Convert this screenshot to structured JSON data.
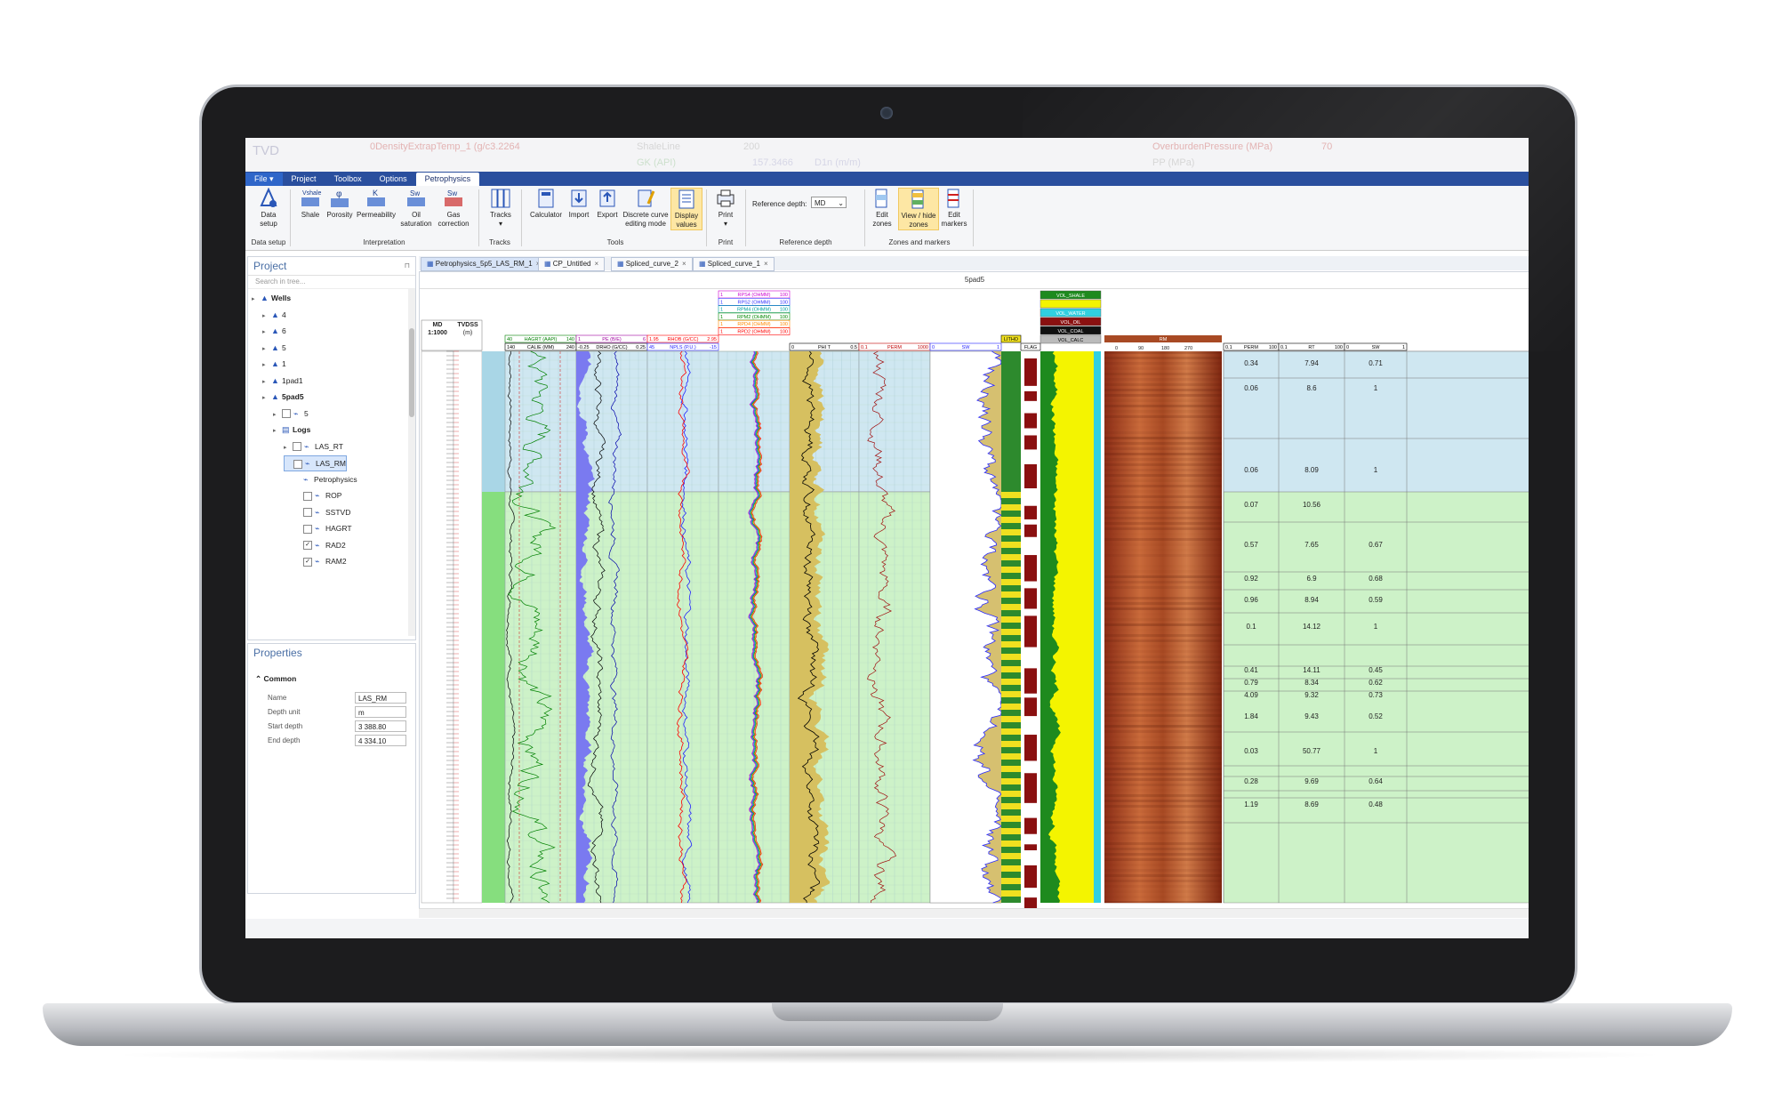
{
  "ribbon_tabs": [
    "File",
    "Project",
    "Toolbox",
    "Options",
    "Petrophysics"
  ],
  "ghost_header": {
    "tvd": "TVD",
    "left": "0DensityExtrapTemp_1 (g/c3.2264",
    "shaleline": "ShaleLine",
    "shaleline_max": "200",
    "overburden": "OverburdenPressure (MPa)",
    "overburden_max": "70",
    "row2_a": "GK (API)",
    "row2_b": "157.3466",
    "row2_c": "D1n (m/m)",
    "row2_d": "PP (MPa)"
  },
  "ribbon": {
    "data_setup": "Data setup",
    "shale": "Shale",
    "porosity": "Porosity",
    "permeability": "Permeability",
    "oil_saturation": "Oil saturation",
    "gas_correction": "Gas correction",
    "tracks": "Tracks",
    "calculator": "Calculator",
    "import": "Import",
    "export": "Export",
    "discrete": "Discrete curve editing mode",
    "display_values": "Display values",
    "print": "Print",
    "reference_depth_label": "Reference depth:",
    "reference_depth_value": "MD",
    "edit_zones": "Edit zones",
    "view_hide_zones": "View / hide zones",
    "edit_markers": "Edit markers",
    "groups": {
      "data_setup": "Data setup",
      "interpretation": "Interpretation",
      "tracks": "Tracks",
      "tools": "Tools",
      "print": "Print",
      "reference_depth": "Reference depth",
      "zones": "Zones and markers"
    }
  },
  "project": {
    "title": "Project",
    "search_placeholder": "Search in tree...",
    "tree": [
      {
        "label": "Wells",
        "level": 0
      },
      {
        "label": "4",
        "level": 1
      },
      {
        "label": "6",
        "level": 1
      },
      {
        "label": "5",
        "level": 1
      },
      {
        "label": "1",
        "level": 1
      },
      {
        "label": "1pad1",
        "level": 1
      },
      {
        "label": "5pad5",
        "level": 1
      },
      {
        "label": "5",
        "level": 2
      },
      {
        "label": "Logs",
        "level": 2
      },
      {
        "label": "LAS_RT",
        "level": 3
      },
      {
        "label": "LAS_RM",
        "level": 3
      },
      {
        "label": "Petrophysics",
        "level": 4
      },
      {
        "label": "ROP",
        "level": 4
      },
      {
        "label": "SSTVD",
        "level": 4
      },
      {
        "label": "HAGRT",
        "level": 4
      },
      {
        "label": "RAD2",
        "level": 4
      },
      {
        "label": "RAM2",
        "level": 4
      }
    ]
  },
  "properties": {
    "title": "Properties",
    "section": "Common",
    "rows": [
      {
        "label": "Name",
        "value": "LAS_RM"
      },
      {
        "label": "Depth unit",
        "value": "m"
      },
      {
        "label": "Start depth",
        "value": "3 388.80"
      },
      {
        "label": "End depth",
        "value": "4 334.10"
      }
    ]
  },
  "doc_tabs": [
    "Petrophysics_5p5_LAS_RM_1",
    "CP_Untitled",
    "Spliced_curve_2",
    "Spliced_curve_1"
  ],
  "log": {
    "well": "5pad5",
    "md_label": "MD",
    "md_scale": "1:1000",
    "tvdss_label": "TVDSS",
    "tvdss_unit": "(m)",
    "resistivity_curves": [
      {
        "name": "RPS4 (OHMM)",
        "min": "1",
        "max": "100",
        "color": "#d000d0"
      },
      {
        "name": "RPS2 (OHMM)",
        "min": "1",
        "max": "100",
        "color": "#3030ff"
      },
      {
        "name": "RPM4 (OHMM)",
        "min": "1",
        "max": "100",
        "color": "#00a0a0"
      },
      {
        "name": "RPM2 (OHMM)",
        "min": "1",
        "max": "100",
        "color": "#008800"
      },
      {
        "name": "RPD4 (OHMM)",
        "min": "1",
        "max": "100",
        "color": "#ff8800"
      },
      {
        "name": "RPD2 (OHMM)",
        "min": "1",
        "max": "100",
        "color": "#ff0000"
      }
    ],
    "track_headers": {
      "hagrt": "HAGRT (AAPI)",
      "hagrt_min": "40",
      "hagrt_max": "140",
      "calie": "CALIE (MM)",
      "calie_min": "140",
      "calie_max": "240",
      "pe": "PE (B/E)",
      "pe_min": "1",
      "pe_max": "6",
      "drho": "DRHO (G/CC)",
      "drho_min": "-0.25",
      "drho_max": "0.25",
      "rhob": "RHOB (G/CC)",
      "rhob_min": "1.95",
      "rhob_max": "2.95",
      "npls": "NPLS (P.U.)",
      "npls_min": "45",
      "npls_max": "-15",
      "phit": "PHI T",
      "phit_min": "0",
      "phit_max": "0.5",
      "perm": "PERM",
      "perm_min": "0.1",
      "perm_max": "1000",
      "sw": "SW",
      "sw_min": "0",
      "sw_max": "1",
      "lith_a": "LITHO",
      "lith_b": "FLAG",
      "vol_shale": "VOL_SHALE",
      "vol_water": "VOL_WATER",
      "vol_oil": "VOL_OIL",
      "vol_coal": "VOL_COAL",
      "vol_calc": "VOL_CALC",
      "rm": "RM",
      "img_ticks": [
        "0",
        "90",
        "180",
        "270"
      ],
      "tab_perm_min": "0.1",
      "tab_perm": "PERM",
      "tab_perm_max": "100",
      "tab_rt_min": "0.1",
      "tab_rt": "RT",
      "tab_rt_max": "100",
      "tab_sw_min": "0",
      "tab_sw": "SW",
      "tab_sw_max": "1"
    },
    "zone_table": [
      {
        "perm": "0.34",
        "rt": "7.94",
        "sw": "0.71"
      },
      {
        "perm": "0.06",
        "rt": "8.6",
        "sw": "1"
      },
      {
        "perm": "0.06",
        "rt": "8.09",
        "sw": "1"
      },
      {
        "perm": "0.07",
        "rt": "10.56",
        "sw": ""
      },
      {
        "perm": "0.57",
        "rt": "7.65",
        "sw": "0.67"
      },
      {
        "perm": "0.92",
        "rt": "6.9",
        "sw": "0.68"
      },
      {
        "perm": "0.96",
        "rt": "8.94",
        "sw": "0.59"
      },
      {
        "perm": "0.1",
        "rt": "14.12",
        "sw": "1"
      },
      {
        "perm": "0.41",
        "rt": "14.11",
        "sw": "0.45"
      },
      {
        "perm": "0.79",
        "rt": "8.34",
        "sw": "0.62"
      },
      {
        "perm": "4.09",
        "rt": "9.32",
        "sw": "0.73"
      },
      {
        "perm": "1.84",
        "rt": "9.43",
        "sw": "0.52"
      },
      {
        "perm": "0.03",
        "rt": "50.77",
        "sw": "1"
      },
      {
        "perm": "0.28",
        "rt": "9.69",
        "sw": "0.64"
      },
      {
        "perm": "1.19",
        "rt": "8.69",
        "sw": "0.48"
      }
    ],
    "colors": {
      "zone_blue": "#cfe7f1",
      "zone_green": "#cdf2c8",
      "zone_blue_strip": "#a9d6e6",
      "zone_green_strip": "#86de7e",
      "gr": "#008000",
      "rhob": "#ff0000",
      "npls": "#2222ff",
      "shale": "#c8a848",
      "sand": "#f4f400"
    }
  }
}
